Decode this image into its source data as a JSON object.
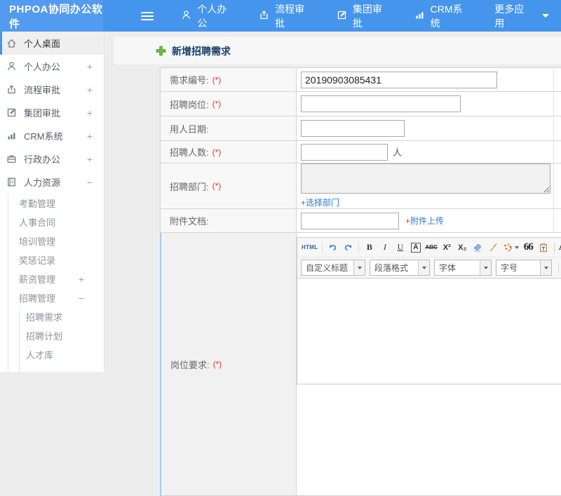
{
  "header": {
    "logo": "PHPOA协同办公软件",
    "nav": [
      {
        "label": "个人办公"
      },
      {
        "label": "流程审批"
      },
      {
        "label": "集团审批"
      },
      {
        "label": "CRM系统"
      },
      {
        "label": "更多应用"
      }
    ]
  },
  "sidebar": {
    "top_items": [
      {
        "label": "个人桌面"
      },
      {
        "label": "个人办公",
        "expander": "+"
      },
      {
        "label": "流程审批",
        "expander": "+"
      },
      {
        "label": "集团审批",
        "expander": "+"
      },
      {
        "label": "CRM系统",
        "expander": "+"
      },
      {
        "label": "行政办公",
        "expander": "+"
      },
      {
        "label": "人力资源",
        "expander": "−"
      }
    ],
    "hr_sub_items": [
      {
        "label": "考勤管理"
      },
      {
        "label": "人事合同"
      },
      {
        "label": "培训管理"
      },
      {
        "label": "奖惩记录"
      },
      {
        "label": "薪资管理",
        "expander": "+"
      },
      {
        "label": "招聘管理",
        "expander": "−"
      }
    ],
    "recruit_sub_items": [
      {
        "label": "招聘需求"
      },
      {
        "label": "招聘计划"
      },
      {
        "label": "人才库"
      }
    ]
  },
  "main": {
    "page_title": "新增招聘需求",
    "form_rows": [
      {
        "label": "需求编号:",
        "mark": "(*)",
        "value": "20190903085431"
      },
      {
        "label": "招聘岗位:",
        "mark": "(*)",
        "value": ""
      },
      {
        "label": "用人日期:",
        "value": ""
      },
      {
        "label": "招聘人数:",
        "mark": "(*)",
        "value": "",
        "suffix": "人"
      },
      {
        "label": "招聘部门:",
        "mark": "(*)",
        "link": {
          "prefix": "+",
          "label": "选择部门"
        }
      },
      {
        "label": "附件文档:",
        "value": "",
        "link": {
          "prefix": "+",
          "label": "附件上传"
        }
      },
      {
        "label": "岗位要求:",
        "mark": "(*)"
      }
    ],
    "editor": {
      "toolbar": {
        "html": "HTML",
        "bold": "B",
        "italic": "I",
        "underline": "U",
        "char_border": "A",
        "strikethrough": "ABC",
        "superscript": "X²",
        "subscript": "X₂",
        "blockquote": "66",
        "font_color": "A",
        "highlight_sample": "a"
      },
      "dropdowns": [
        {
          "label": "自定义标题"
        },
        {
          "label": "段落格式"
        },
        {
          "label": "字体"
        },
        {
          "label": "字号"
        }
      ]
    }
  },
  "colors": {
    "header_blue": "#4695ec",
    "link_blue": "#2b7bd0",
    "required_red": "#e5352b",
    "title_navy": "#17406b",
    "plus_green": "#72bf3f"
  }
}
